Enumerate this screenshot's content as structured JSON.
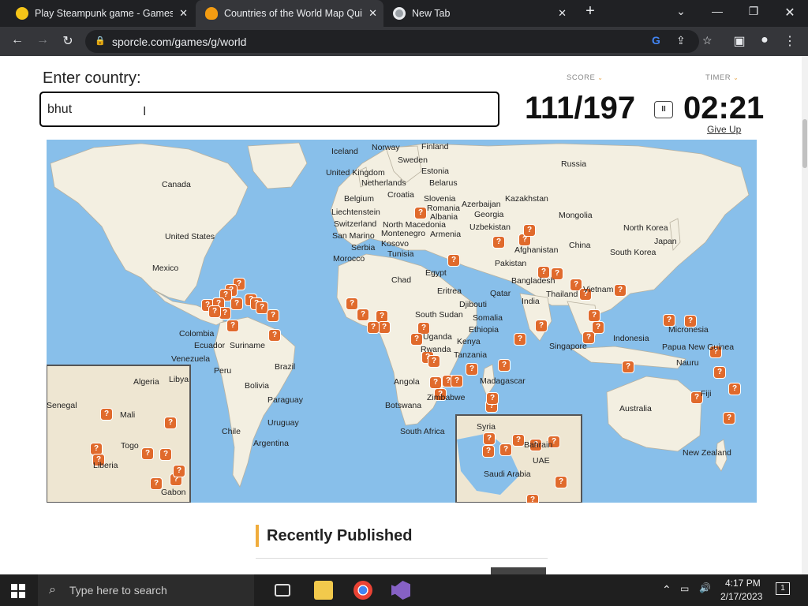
{
  "browser": {
    "tabs": [
      {
        "title": "Play Steampunk game - Gamesfl",
        "active": false
      },
      {
        "title": "Countries of the World Map Quiz",
        "active": true
      },
      {
        "title": "New Tab",
        "active": false
      }
    ],
    "url": "sporcle.com/games/g/world"
  },
  "quiz": {
    "input_label": "Enter country:",
    "input_value": "bhut",
    "score_label": "SCORE",
    "timer_label": "TIMER",
    "score": "111/197",
    "pause_symbol": "II",
    "timer": "02:21",
    "give_up": "Give Up"
  },
  "map": {
    "labels": [
      "Iceland",
      "Norway",
      "Finland",
      "Sweden",
      "Russia",
      "United Kingdom",
      "Estonia",
      "Netherlands",
      "Belarus",
      "Canada",
      "Croatia",
      "Belgium",
      "Slovenia",
      "Kazakhstan",
      "Azerbaijan",
      "Romania",
      "Liechtenstein",
      "Georgia",
      "Albania",
      "Mongolia",
      "Switzerland",
      "North Macedonia",
      "Uzbekistan",
      "United States",
      "San Marino",
      "Montenegro",
      "Armenia",
      "North Korea",
      "Kosovo",
      "Serbia",
      "Japan",
      "Afghanistan",
      "China",
      "Tunisia",
      "South Korea",
      "Morocco",
      "Pakistan",
      "Mexico",
      "Egypt",
      "Chad",
      "Bangladesh",
      "Vietnam",
      "Eritrea",
      "Qatar",
      "Thailand",
      "India",
      "Djibouti",
      "South Sudan",
      "Somalia",
      "Micronesia",
      "Colombia",
      "Ethiopia",
      "Uganda",
      "Ecuador",
      "Suriname",
      "Indonesia",
      "Kenya",
      "Singapore",
      "Papua New Guinea",
      "Rwanda",
      "Venezuela",
      "Tanzania",
      "Nauru",
      "Brazil",
      "Peru",
      "Algeria",
      "Libya",
      "Madagascar",
      "Bolivia",
      "Angola",
      "Fiji",
      "Senegal",
      "Mali",
      "Zimbabwe",
      "Paraguay",
      "Botswana",
      "Australia",
      "Uruguay",
      "Syria",
      "Chile",
      "South Africa",
      "Togo",
      "Argentina",
      "Bahrain",
      "UAE",
      "Liberia",
      "Saudi Arabia",
      "New Zealand",
      "Gabon"
    ]
  },
  "recently_published": "Recently Published",
  "taskbar": {
    "search_placeholder": "Type here to search",
    "time": "4:17 PM",
    "date": "2/17/2023",
    "notifications": "1"
  }
}
